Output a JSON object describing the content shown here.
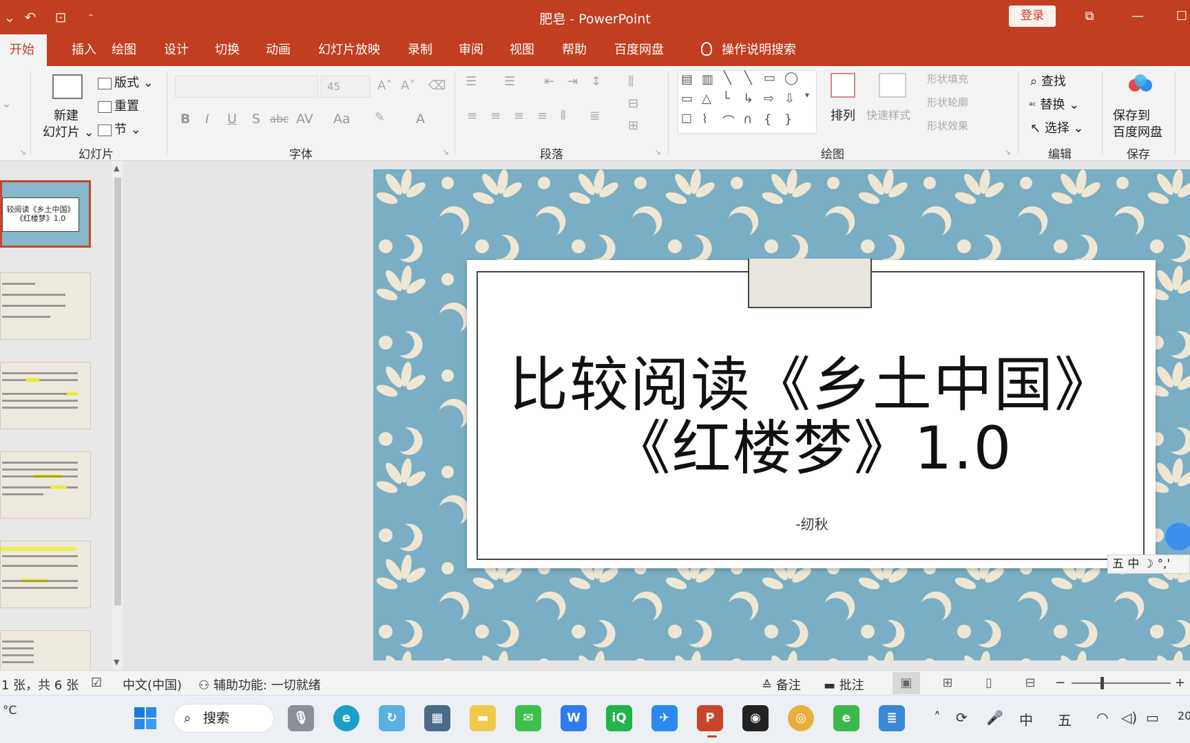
{
  "titlebar": {
    "doc_title": "肥皂  -  PowerPoint",
    "login": "登录",
    "minimize": "—",
    "maximize": "☐"
  },
  "tabs": [
    "开始",
    "插入",
    "绘图",
    "设计",
    "切换",
    "动画",
    "幻灯片放映",
    "录制",
    "审阅",
    "视图",
    "帮助",
    "百度网盘"
  ],
  "tell_me": "操作说明搜索",
  "ribbon": {
    "slides": {
      "new_slide_line1": "新建",
      "new_slide_line2": "幻灯片",
      "layout": "版式",
      "reset": "重置",
      "section": "节",
      "group_label": "幻灯片"
    },
    "font": {
      "size_placeholder": "45",
      "bold": "B",
      "italic": "I",
      "underline": "U",
      "strike": "S",
      "abc": "abc",
      "spacing": "AV",
      "case": "Aa",
      "color": "A",
      "group_label": "字体"
    },
    "paragraph": {
      "group_label": "段落"
    },
    "drawing": {
      "arrange": "排列",
      "quick_styles": "快速样式",
      "shape_fill": "形状填充",
      "shape_outline": "形状轮廓",
      "shape_effects": "形状效果",
      "group_label": "绘图"
    },
    "editing": {
      "find": "查找",
      "replace": "替换",
      "select": "选择",
      "group_label": "编辑"
    },
    "save": {
      "line1": "保存到",
      "line2": "百度网盘",
      "group_label": "保存"
    }
  },
  "slide": {
    "title_line1": "比较阅读《乡土中国》",
    "title_line2": "《红楼梦》1.0",
    "subtitle": "-纫秋"
  },
  "thumbnails": {
    "first_caption_line1": "较阅读《乡土中国》",
    "first_caption_line2": "《红楼梦》1.0"
  },
  "ime": {
    "text": "五 中 ☽ °,'"
  },
  "statusbar": {
    "slide_count": "1 张，共 6 张",
    "language": "中文(中国)",
    "accessibility": "辅助功能: 一切就绪",
    "notes": "备注",
    "comments": "批注",
    "zoom_minus": "−",
    "zoom_plus": "+"
  },
  "taskbar": {
    "weather": "°C",
    "search": "搜索",
    "clock": "20"
  },
  "colors": {
    "accent": "#c23e21",
    "slide_background": "#7aaec4",
    "pattern": "#efe7d4"
  }
}
